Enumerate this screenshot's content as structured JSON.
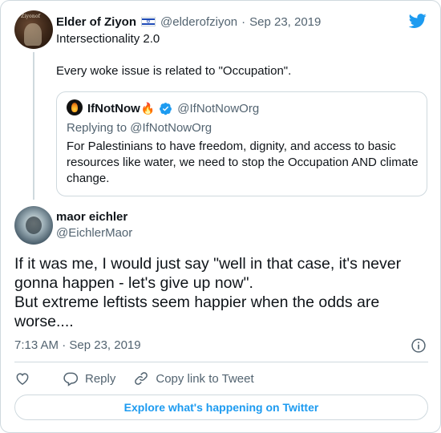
{
  "parent_tweet": {
    "avatar_text": "Ziyonof",
    "name": "Elder of Ziyon",
    "flag_icon": "israel-flag-icon",
    "handle": "@elderofziyon",
    "separator": "·",
    "date": "Sep 23, 2019",
    "text": "Intersectionality 2.0\n\nEvery woke issue is related to \"Occupation\"."
  },
  "quoted_tweet": {
    "name": "IfNotNow",
    "emoji": "🔥",
    "verified_icon": "verified-badge-icon",
    "handle": "@IfNotNowOrg",
    "replying_to": "Replying to @IfNotNowOrg",
    "text": "For Palestinians to have freedom, dignity, and access to basic resources like water, we need to stop the Occupation AND climate change."
  },
  "main_tweet": {
    "name": "maor eichler",
    "handle": "@EichlerMaor",
    "text_line1": "If it was me, I would just say \"well in that case, it's never gonna happen - let's give up now\".",
    "text_line2": "But extreme leftists seem happier when the odds are worse....",
    "timestamp": "7:13 AM · Sep 23, 2019"
  },
  "actions": {
    "reply_label": "Reply",
    "copy_link_label": "Copy link to Tweet"
  },
  "explore_button": "Explore what's happening on Twitter",
  "colors": {
    "accent": "#1d9bf0",
    "text": "#0f1419",
    "muted": "#536471",
    "border": "#cfd9de"
  }
}
